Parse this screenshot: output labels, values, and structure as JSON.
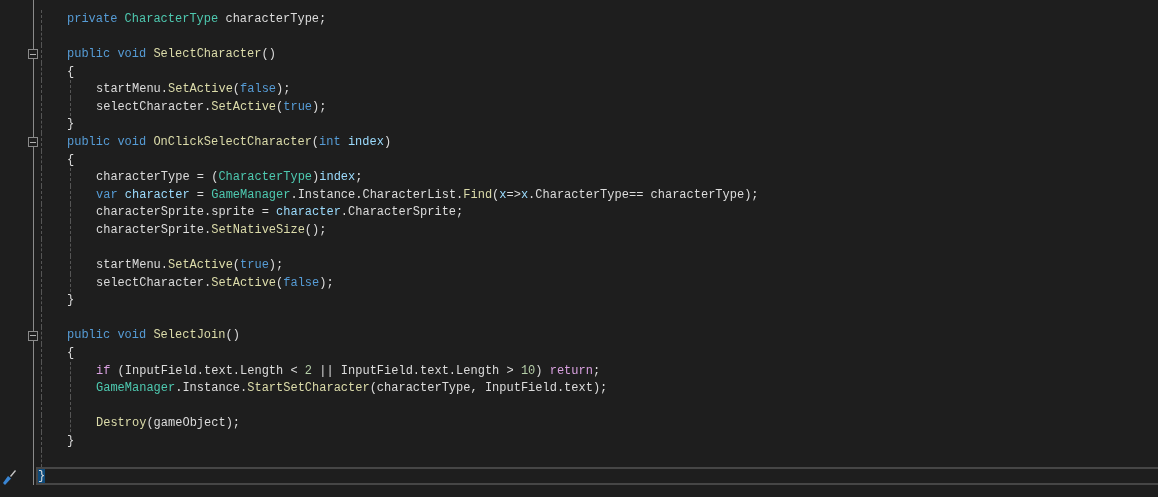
{
  "editor": {
    "lines": [
      {
        "kind": "code",
        "in_class": true,
        "in_method": false,
        "foldable": false,
        "current": false,
        "tokens": [
          {
            "text": "private ",
            "kind": "keyword"
          },
          {
            "text": "CharacterType",
            "kind": "type"
          },
          {
            "text": " characterType;",
            "kind": "plain"
          }
        ]
      },
      {
        "kind": "blank",
        "foldable": false,
        "current": false
      },
      {
        "kind": "code",
        "in_class": true,
        "in_method": false,
        "foldable": true,
        "current": false,
        "tokens": [
          {
            "text": "public void ",
            "kind": "keyword"
          },
          {
            "text": "SelectCharacter",
            "kind": "method"
          },
          {
            "text": "()",
            "kind": "plain"
          }
        ]
      },
      {
        "kind": "code",
        "in_class": true,
        "in_method": false,
        "foldable": false,
        "current": false,
        "tokens": [
          {
            "text": "{",
            "kind": "plain"
          }
        ]
      },
      {
        "kind": "code",
        "in_class": true,
        "in_method": true,
        "foldable": false,
        "current": false,
        "tokens": [
          {
            "text": "startMenu.",
            "kind": "plain"
          },
          {
            "text": "SetActive",
            "kind": "method"
          },
          {
            "text": "(",
            "kind": "plain"
          },
          {
            "text": "false",
            "kind": "keyword"
          },
          {
            "text": ");",
            "kind": "plain"
          }
        ]
      },
      {
        "kind": "code",
        "in_class": true,
        "in_method": true,
        "foldable": false,
        "current": false,
        "tokens": [
          {
            "text": "selectCharacter.",
            "kind": "plain"
          },
          {
            "text": "SetActive",
            "kind": "method"
          },
          {
            "text": "(",
            "kind": "plain"
          },
          {
            "text": "true",
            "kind": "keyword"
          },
          {
            "text": ");",
            "kind": "plain"
          }
        ]
      },
      {
        "kind": "code",
        "in_class": true,
        "in_method": false,
        "foldable": false,
        "current": false,
        "tokens": [
          {
            "text": "}",
            "kind": "plain"
          }
        ]
      },
      {
        "kind": "code",
        "in_class": true,
        "in_method": false,
        "foldable": true,
        "current": false,
        "tokens": [
          {
            "text": "public void ",
            "kind": "keyword"
          },
          {
            "text": "OnClickSelectCharacter",
            "kind": "method"
          },
          {
            "text": "(",
            "kind": "plain"
          },
          {
            "text": "int ",
            "kind": "keyword"
          },
          {
            "text": "index",
            "kind": "param"
          },
          {
            "text": ")",
            "kind": "plain"
          }
        ]
      },
      {
        "kind": "code",
        "in_class": true,
        "in_method": false,
        "foldable": false,
        "current": false,
        "tokens": [
          {
            "text": "{",
            "kind": "plain"
          }
        ]
      },
      {
        "kind": "code",
        "in_class": true,
        "in_method": true,
        "foldable": false,
        "current": false,
        "tokens": [
          {
            "text": "characterType = (",
            "kind": "plain"
          },
          {
            "text": "CharacterType",
            "kind": "type"
          },
          {
            "text": ")",
            "kind": "plain"
          },
          {
            "text": "index",
            "kind": "param"
          },
          {
            "text": ";",
            "kind": "plain"
          }
        ]
      },
      {
        "kind": "code",
        "in_class": true,
        "in_method": true,
        "foldable": false,
        "current": false,
        "tokens": [
          {
            "text": "var ",
            "kind": "keyword"
          },
          {
            "text": "character",
            "kind": "param"
          },
          {
            "text": " = ",
            "kind": "plain"
          },
          {
            "text": "GameManager",
            "kind": "type"
          },
          {
            "text": ".Instance.CharacterList.",
            "kind": "plain"
          },
          {
            "text": "Find",
            "kind": "method"
          },
          {
            "text": "(",
            "kind": "plain"
          },
          {
            "text": "x",
            "kind": "param"
          },
          {
            "text": "=>",
            "kind": "plain"
          },
          {
            "text": "x",
            "kind": "param"
          },
          {
            "text": ".CharacterType== characterType);",
            "kind": "plain"
          }
        ]
      },
      {
        "kind": "code",
        "in_class": true,
        "in_method": true,
        "foldable": false,
        "current": false,
        "tokens": [
          {
            "text": "characterSprite.sprite = ",
            "kind": "plain"
          },
          {
            "text": "character",
            "kind": "param"
          },
          {
            "text": ".CharacterSprite;",
            "kind": "plain"
          }
        ]
      },
      {
        "kind": "code",
        "in_class": true,
        "in_method": true,
        "foldable": false,
        "current": false,
        "tokens": [
          {
            "text": "characterSprite.",
            "kind": "plain"
          },
          {
            "text": "SetNativeSize",
            "kind": "method"
          },
          {
            "text": "();",
            "kind": "plain"
          }
        ]
      },
      {
        "kind": "blank",
        "foldable": false,
        "current": false
      },
      {
        "kind": "code",
        "in_class": true,
        "in_method": true,
        "foldable": false,
        "current": false,
        "tokens": [
          {
            "text": "startMenu.",
            "kind": "plain"
          },
          {
            "text": "SetActive",
            "kind": "method"
          },
          {
            "text": "(",
            "kind": "plain"
          },
          {
            "text": "true",
            "kind": "keyword"
          },
          {
            "text": ");",
            "kind": "plain"
          }
        ]
      },
      {
        "kind": "code",
        "in_class": true,
        "in_method": true,
        "foldable": false,
        "current": false,
        "tokens": [
          {
            "text": "selectCharacter.",
            "kind": "plain"
          },
          {
            "text": "SetActive",
            "kind": "method"
          },
          {
            "text": "(",
            "kind": "plain"
          },
          {
            "text": "false",
            "kind": "keyword"
          },
          {
            "text": ");",
            "kind": "plain"
          }
        ]
      },
      {
        "kind": "code",
        "in_class": true,
        "in_method": false,
        "foldable": false,
        "current": false,
        "tokens": [
          {
            "text": "}",
            "kind": "plain"
          }
        ]
      },
      {
        "kind": "blank",
        "foldable": false,
        "current": false
      },
      {
        "kind": "code",
        "in_class": true,
        "in_method": false,
        "foldable": true,
        "current": false,
        "tokens": [
          {
            "text": "public void ",
            "kind": "keyword"
          },
          {
            "text": "SelectJoin",
            "kind": "method"
          },
          {
            "text": "()",
            "kind": "plain"
          }
        ]
      },
      {
        "kind": "code",
        "in_class": true,
        "in_method": false,
        "foldable": false,
        "current": false,
        "tokens": [
          {
            "text": "{",
            "kind": "plain"
          }
        ]
      },
      {
        "kind": "code",
        "in_class": true,
        "in_method": true,
        "foldable": false,
        "current": false,
        "tokens": [
          {
            "text": "if",
            "kind": "control"
          },
          {
            "text": " (InputField.text.Length < ",
            "kind": "plain"
          },
          {
            "text": "2",
            "kind": "number"
          },
          {
            "text": " || InputField.text.Length > ",
            "kind": "plain"
          },
          {
            "text": "10",
            "kind": "number"
          },
          {
            "text": ") ",
            "kind": "plain"
          },
          {
            "text": "return",
            "kind": "control"
          },
          {
            "text": ";",
            "kind": "plain"
          }
        ]
      },
      {
        "kind": "code",
        "in_class": true,
        "in_method": true,
        "foldable": false,
        "current": false,
        "tokens": [
          {
            "text": "GameManager",
            "kind": "type"
          },
          {
            "text": ".Instance.",
            "kind": "plain"
          },
          {
            "text": "StartSetCharacter",
            "kind": "method"
          },
          {
            "text": "(characterType, InputField.text);",
            "kind": "plain"
          }
        ]
      },
      {
        "kind": "blank",
        "foldable": false,
        "current": false
      },
      {
        "kind": "code",
        "in_class": true,
        "in_method": true,
        "foldable": false,
        "current": false,
        "tokens": [
          {
            "text": "Destroy",
            "kind": "method"
          },
          {
            "text": "(gameObject);",
            "kind": "plain"
          }
        ]
      },
      {
        "kind": "code",
        "in_class": true,
        "in_method": false,
        "foldable": false,
        "current": false,
        "tokens": [
          {
            "text": "}",
            "kind": "plain"
          }
        ]
      },
      {
        "kind": "blank",
        "foldable": false,
        "current": false
      },
      {
        "kind": "code",
        "in_class": false,
        "in_method": false,
        "foldable": false,
        "current": true,
        "tokens": [
          {
            "text": "}",
            "kind": "brace-match"
          }
        ]
      }
    ]
  }
}
